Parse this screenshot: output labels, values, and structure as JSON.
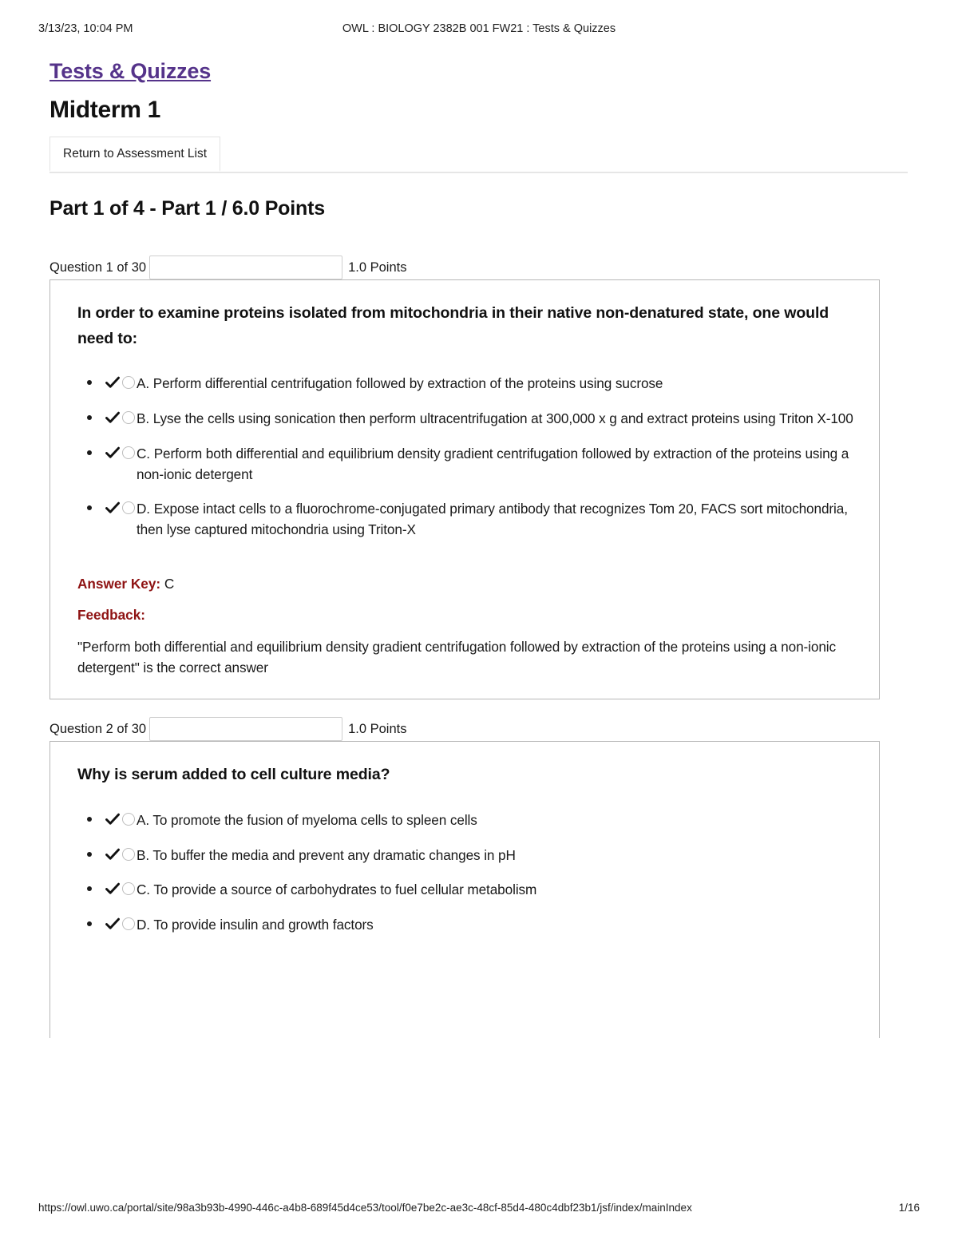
{
  "print_header": {
    "date": "3/13/23, 10:04 PM",
    "title": "OWL : BIOLOGY 2382B 001 FW21 : Tests & Quizzes"
  },
  "tool_link": {
    "label": "Tests & Quizzes",
    "color": "#55338a"
  },
  "assessment": {
    "title": "Midterm 1"
  },
  "tabs": [
    {
      "label": "Return to Assessment List"
    }
  ],
  "part_heading": "Part 1 of 4 - Part 1 / 6.0 Points",
  "labels": {
    "answer_key": "Answer Key:",
    "feedback": "Feedback:"
  },
  "colors": {
    "link_purple": "#55338a",
    "answer_key_red": "#8e1212",
    "question_border": "#b7b7b7",
    "input_border": "#cfcfcf"
  },
  "questions": [
    {
      "number_label": "Question 1 of 30",
      "blank_value": "",
      "points_label": "1.0 Points",
      "text": "In order to examine proteins isolated from mitochondria in their native non-denatured state, one would need to:",
      "options": [
        {
          "letter": "A.",
          "text": "Perform differential centrifugation followed by extraction of the proteins using sucrose"
        },
        {
          "letter": "B.",
          "text": "Lyse the cells using sonication then perform ultracentrifugation at 300,000 x g and extract proteins using Triton X-100"
        },
        {
          "letter": "C.",
          "text": "Perform both differential and equilibrium density gradient centrifugation followed by extraction of the proteins using a non-ionic detergent"
        },
        {
          "letter": "D.",
          "text": "Expose intact cells to a fluorochrome-conjugated primary antibody that recognizes Tom 20, FACS sort mitochondria, then lyse captured mitochondria using Triton-X"
        }
      ],
      "answer_key": "C",
      "feedback": "\"Perform both differential and equilibrium density gradient centrifugation followed by extraction of the proteins using a non-ionic detergent\" is the correct answer"
    },
    {
      "number_label": "Question 2 of 30",
      "blank_value": "",
      "points_label": "1.0 Points",
      "text": "Why is serum added to cell culture media?",
      "options": [
        {
          "letter": "A.",
          "text": "To promote the fusion of myeloma cells to spleen cells"
        },
        {
          "letter": "B.",
          "text": "To buffer the media and prevent any dramatic changes in pH"
        },
        {
          "letter": "C.",
          "text": "To provide a source of carbohydrates to fuel cellular metabolism"
        },
        {
          "letter": "D.",
          "text": "To provide insulin and growth factors"
        }
      ],
      "answer_key": "",
      "feedback": ""
    }
  ],
  "print_footer": {
    "url": "https://owl.uwo.ca/portal/site/98a3b93b-4990-446c-a4b8-689f45d4ce53/tool/f0e7be2c-ae3c-48cf-85d4-480c4dbf23b1/jsf/index/mainIndex",
    "page": "1/16"
  }
}
